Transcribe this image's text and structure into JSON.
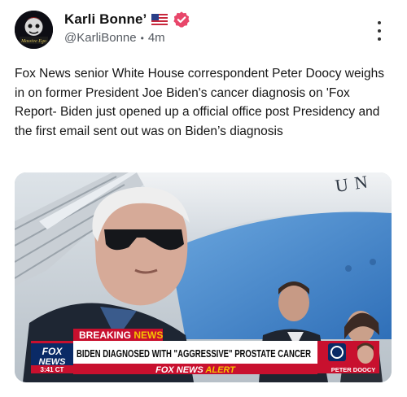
{
  "author": {
    "display_name": "Karli Bonne’",
    "handle": "@KarliBonne",
    "time_ago": "4m",
    "flag_icon": "us-flag-icon",
    "badge_icon": "verified-badge-icon",
    "badge_color": "#e8466a",
    "avatar_text": "Massive Ego"
  },
  "post": {
    "text": "Fox News senior White House correspondent Peter Doocy weighs in on former President Joe Biden's cancer diagnosis on 'Fox Report- Biden just opened up a official office post Presidency and the first email sent out was on Biden’s diagnosis"
  },
  "media": {
    "plane_lettering": "UN",
    "breaking_label": "BREAKING",
    "news_label": "NEWS",
    "headline": "BIDEN DIAGNOSED WITH \"AGGRESSIVE\" PROSTATE CANCER",
    "network_top": "FOX",
    "network_bottom": "NEWS",
    "clock": "3:41 CT",
    "alert_brand": "FOX NEWS",
    "alert_word": "ALERT",
    "reporter_name": "PETER DOOCY",
    "colors": {
      "breaking_red": "#c8102e",
      "fox_blue": "#0a2a66",
      "alert_yellow": "#f5c400"
    }
  }
}
